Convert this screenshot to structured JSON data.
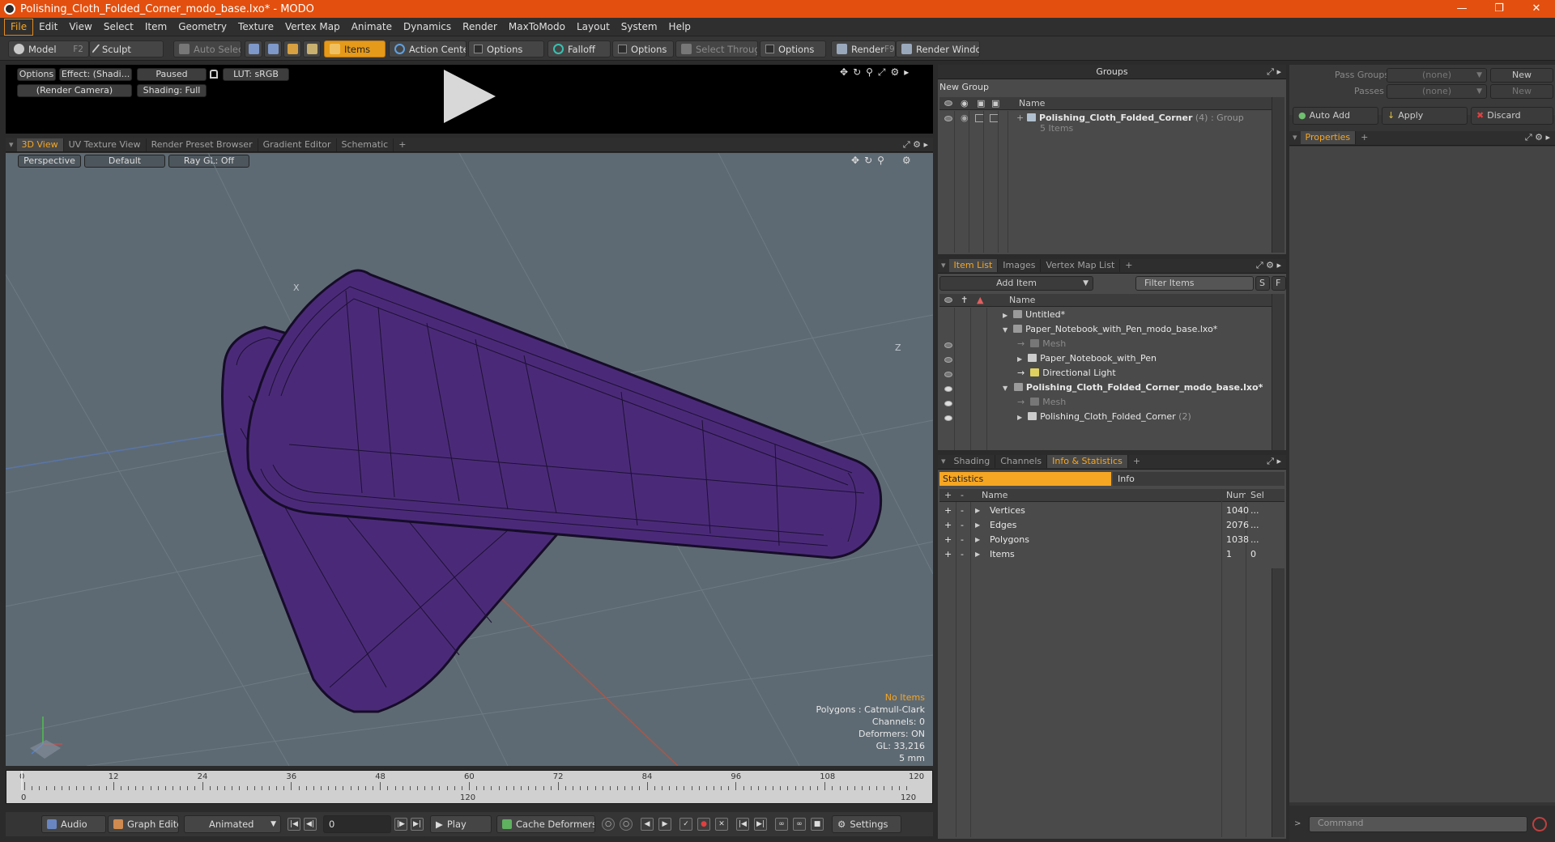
{
  "window": {
    "title": "Polishing_Cloth_Folded_Corner_modo_base.lxo* - MODO"
  },
  "menu": [
    "File",
    "Edit",
    "View",
    "Select",
    "Item",
    "Geometry",
    "Texture",
    "Vertex Map",
    "Animate",
    "Dynamics",
    "Render",
    "MaxToModo",
    "Layout",
    "System",
    "Help"
  ],
  "toolbar": {
    "model": "Model",
    "model_key": "F2",
    "sculpt": "Sculpt",
    "auto_select": "Auto Select",
    "items": "Items",
    "action_center": "Action Center",
    "options": "Options",
    "falloff": "Falloff",
    "select_through": "Select Through",
    "render": "Render",
    "render_key": "F9",
    "render_window": "Render Window"
  },
  "preview": {
    "options": "Options",
    "effect": "Effect: (Shadi...",
    "paused": "Paused",
    "lut": "LUT: sRGB",
    "camera": "(Render Camera)",
    "shading": "Shading: Full"
  },
  "viewport_tabs": [
    "3D View",
    "UV Texture View",
    "Render Preset Browser",
    "Gradient Editor",
    "Schematic",
    "+"
  ],
  "viewport": {
    "perspective": "Perspective",
    "default": "Default",
    "raygl": "Ray GL: Off",
    "axis_x": "X",
    "axis_z": "Z",
    "overlay": {
      "no_items": "No Items",
      "polygons": "Polygons : Catmull-Clark",
      "channels": "Channels: 0",
      "deformers": "Deformers: ON",
      "gl": "GL: 33,216",
      "scale": "5 mm"
    },
    "colors": {
      "bg": "#5e6a73",
      "mesh": "#4a2a78",
      "wire": "#160c28"
    }
  },
  "timeline": {
    "ticks": [
      "0",
      "12",
      "24",
      "36",
      "48",
      "60",
      "72",
      "84",
      "96",
      "108",
      "120"
    ],
    "lower": [
      "0",
      "120",
      "120"
    ]
  },
  "bottom": {
    "audio": "Audio",
    "graph_editor": "Graph Editor",
    "animated": "Animated",
    "frame": "0",
    "play": "Play",
    "cache_deformers": "Cache Deformers",
    "settings": "Settings"
  },
  "groups": {
    "title": "Groups",
    "new_group": "New Group",
    "col_name": "Name",
    "group_name": "Polishing_Cloth_Folded_Corner",
    "group_count": "(4)",
    "group_type": ": Group",
    "group_items": "5 Items"
  },
  "itemlist": {
    "tabs": [
      "Item List",
      "Images",
      "Vertex Map List",
      "+"
    ],
    "add_item": "Add Item",
    "filter": "Filter Items",
    "s": "S",
    "f": "F",
    "col_name": "Name",
    "rows": [
      {
        "label": "Untitled*"
      },
      {
        "label": "Paper_Notebook_with_Pen_modo_base.lxo*"
      },
      {
        "label": "Mesh"
      },
      {
        "label": "Paper_Notebook_with_Pen"
      },
      {
        "label": "Directional Light"
      },
      {
        "label": "Polishing_Cloth_Folded_Corner_modo_base.lxo*"
      },
      {
        "label": "Mesh"
      },
      {
        "label": "Polishing_Cloth_Folded_Corner",
        "suffix": "(2)"
      }
    ]
  },
  "stats": {
    "tabs": [
      "Shading",
      "Channels",
      "Info & Statistics",
      "+"
    ],
    "statistics": "Statistics",
    "info": "Info",
    "col_name": "Name",
    "col_num": "Num",
    "col_sel": "Sel",
    "plus": "+",
    "minus": "-",
    "rows": [
      {
        "name": "Vertices",
        "num": "1040",
        "sel": "..."
      },
      {
        "name": "Edges",
        "num": "2076",
        "sel": "..."
      },
      {
        "name": "Polygons",
        "num": "1038",
        "sel": "..."
      },
      {
        "name": "Items",
        "num": "1",
        "sel": "0"
      }
    ]
  },
  "right": {
    "pass_groups": "Pass Groups",
    "passes": "Passes",
    "none": "(none)",
    "new": "New",
    "auto_add": "Auto Add",
    "apply": "Apply",
    "discard": "Discard",
    "properties": "Properties",
    "plus": "+",
    "command": "Command"
  }
}
